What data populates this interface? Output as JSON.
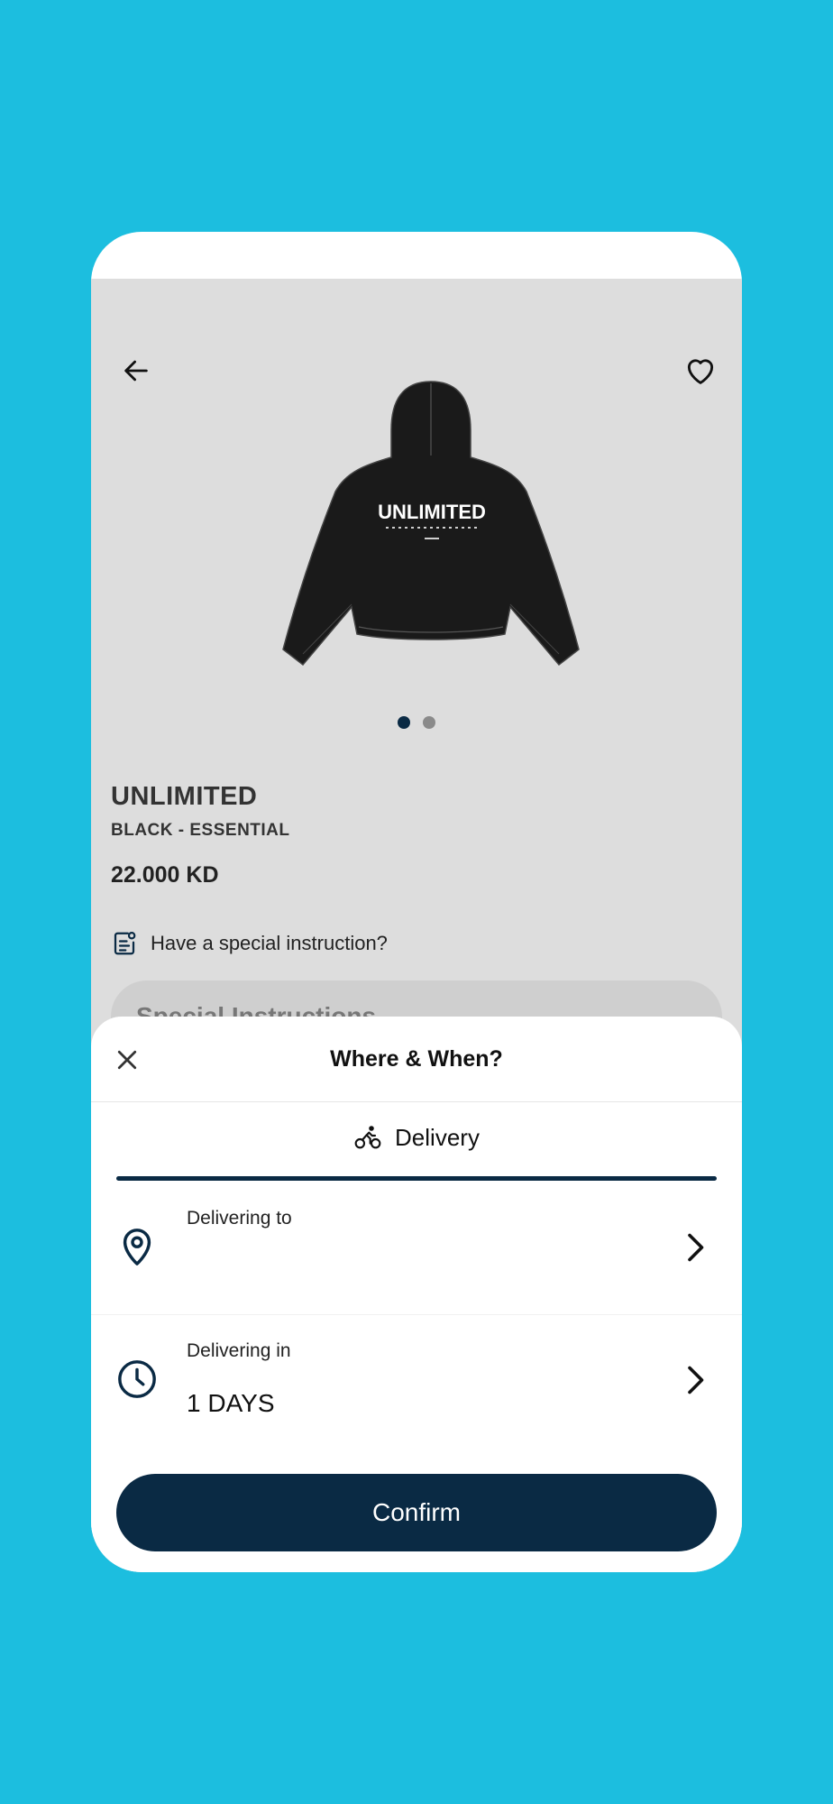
{
  "product": {
    "name": "UNLIMITED",
    "variant": "BLACK - ESSENTIAL",
    "price": "22.000 KD",
    "image_print": "UNLIMITED",
    "carousel": {
      "count": 2,
      "active": 1
    }
  },
  "instructions": {
    "prompt": "Have a special instruction?",
    "placeholder": "Special Instructions"
  },
  "sheet": {
    "title": "Where & When?",
    "tab_label": "Delivery",
    "rows": [
      {
        "label": "Delivering to",
        "value": "",
        "icon": "location-pin-icon"
      },
      {
        "label": "Delivering in",
        "value": "1 DAYS",
        "icon": "clock-icon"
      }
    ],
    "confirm_label": "Confirm"
  },
  "colors": {
    "background": "#1cbedf",
    "accent": "#0a2a44",
    "product_bg": "#dddddd"
  },
  "icons": [
    "back-arrow-icon",
    "heart-icon",
    "note-icon",
    "close-icon",
    "bicycle-icon",
    "location-pin-icon",
    "clock-icon",
    "chevron-right-icon"
  ]
}
